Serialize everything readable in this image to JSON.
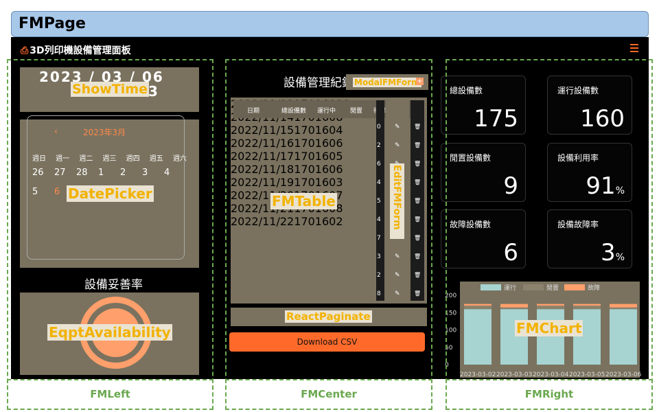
{
  "page_title": "FMPage",
  "app": {
    "icon": "printer-icon",
    "title": "3D列印機設備管理面板",
    "menu_icon": "hamburger-icon"
  },
  "labels": {
    "left": "FMLeft",
    "center": "FMCenter",
    "right": "FMRight"
  },
  "tags": {
    "show_time": "ShowTime",
    "date_picker": "DatePicker",
    "eqpt_availability": "EqptAvailability",
    "modal_form": "ModalFMForm",
    "fm_table": "FMTable",
    "edit_form": "EditFMForm",
    "paginate": "ReactPaginate",
    "fm_chart": "FMChart"
  },
  "left": {
    "clock": "2023 / 03 / 06",
    "clock_tail": "3",
    "calendar": {
      "prev": "‹",
      "month": "2023年3月",
      "weekdays": [
        "週日",
        "週一",
        "週二",
        "週三",
        "週四",
        "週五",
        "週六"
      ],
      "row1": [
        "26",
        "27",
        "28",
        "1",
        "2",
        "3",
        "4"
      ],
      "row2": [
        "5",
        "6"
      ]
    },
    "availability_title": "設備妥善率"
  },
  "center": {
    "title": "設備管理紀錄",
    "add_icon": "plus-icon",
    "table": {
      "headers": [
        "日期",
        "總設備數",
        "運行中",
        "閒置",
        "待修"
      ],
      "rows": [
        [
          "2022/11/13",
          "170",
          "160",
          "10",
          "0"
        ],
        [
          "2022/11/14",
          "170",
          "160",
          "8",
          "2"
        ],
        [
          "2022/11/15",
          "170",
          "160",
          "4",
          "6"
        ],
        [
          "2022/11/16",
          "170",
          "160",
          "6",
          "4"
        ],
        [
          "2022/11/17",
          "170",
          "160",
          "5",
          "5"
        ],
        [
          "2022/11/18",
          "170",
          "160",
          "6",
          "4"
        ],
        [
          "2022/11/19",
          "170",
          "160",
          "3",
          "7"
        ],
        [
          "2022/11/20",
          "170",
          "160",
          "7",
          "3"
        ],
        [
          "2022/11/21",
          "170",
          "160",
          "8",
          "2"
        ],
        [
          "2022/11/22",
          "170",
          "160",
          "2",
          "8"
        ]
      ],
      "edit_icon": "✎",
      "delete_icon": "🗑"
    },
    "download": "Download CSV"
  },
  "right": {
    "kpis": [
      {
        "label": "總設備數",
        "value": "175",
        "unit": ""
      },
      {
        "label": "運行設備數",
        "value": "160",
        "unit": ""
      },
      {
        "label": "閒置設備數",
        "value": "9",
        "unit": ""
      },
      {
        "label": "設備利用率",
        "value": "91",
        "unit": "%"
      },
      {
        "label": "故障設備數",
        "value": "6",
        "unit": ""
      },
      {
        "label": "設備故障率",
        "value": "3",
        "unit": "%"
      }
    ]
  },
  "chart_data": {
    "type": "bar",
    "categories": [
      "2023-03-02",
      "2023-03-03",
      "2023-03-04",
      "2023-03-05",
      "2023-03-06"
    ],
    "series": [
      {
        "name": "運行",
        "values": [
          160,
          160,
          160,
          160,
          160
        ],
        "color": "#a7d3d0"
      },
      {
        "name": "閒置",
        "values": [
          10,
          5,
          10,
          10,
          5
        ],
        "color": "#8a826d"
      },
      {
        "name": "故障",
        "values": [
          5,
          10,
          5,
          5,
          10
        ],
        "color": "#ff9f6b"
      }
    ],
    "ylim": [
      0,
      200
    ],
    "yticks": [
      "200",
      "150",
      "100",
      "50",
      "0"
    ]
  },
  "colors": {
    "accent": "#ff6a2a",
    "panel": "#7a725f",
    "frame": "#6aa84f",
    "tag_text": "#f2b200"
  }
}
